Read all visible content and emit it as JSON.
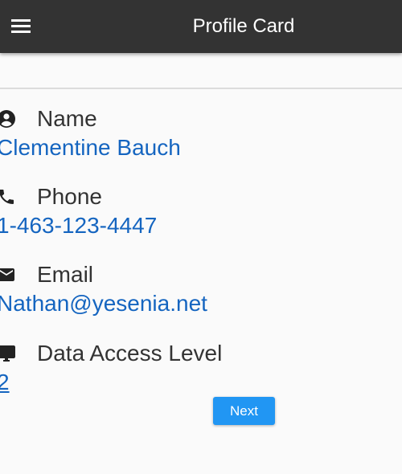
{
  "header": {
    "title": "Profile Card",
    "menu_icon": "menu-icon"
  },
  "fields": [
    {
      "label": "Name",
      "value": "Clementine Bauch",
      "icon": "account-circle-icon"
    },
    {
      "label": "Phone",
      "value": "1-463-123-4447",
      "icon": "phone-icon"
    },
    {
      "label": "Email",
      "value": "Nathan@yesenia.net",
      "icon": "email-icon"
    },
    {
      "label": "Data Access Level",
      "value": "2",
      "icon": "monitor-icon"
    }
  ],
  "actions": {
    "next_label": "Next"
  },
  "colors": {
    "appbar": "#333333",
    "value_text": "#1565c0",
    "button": "#2196f3",
    "background": "#fafafa"
  }
}
